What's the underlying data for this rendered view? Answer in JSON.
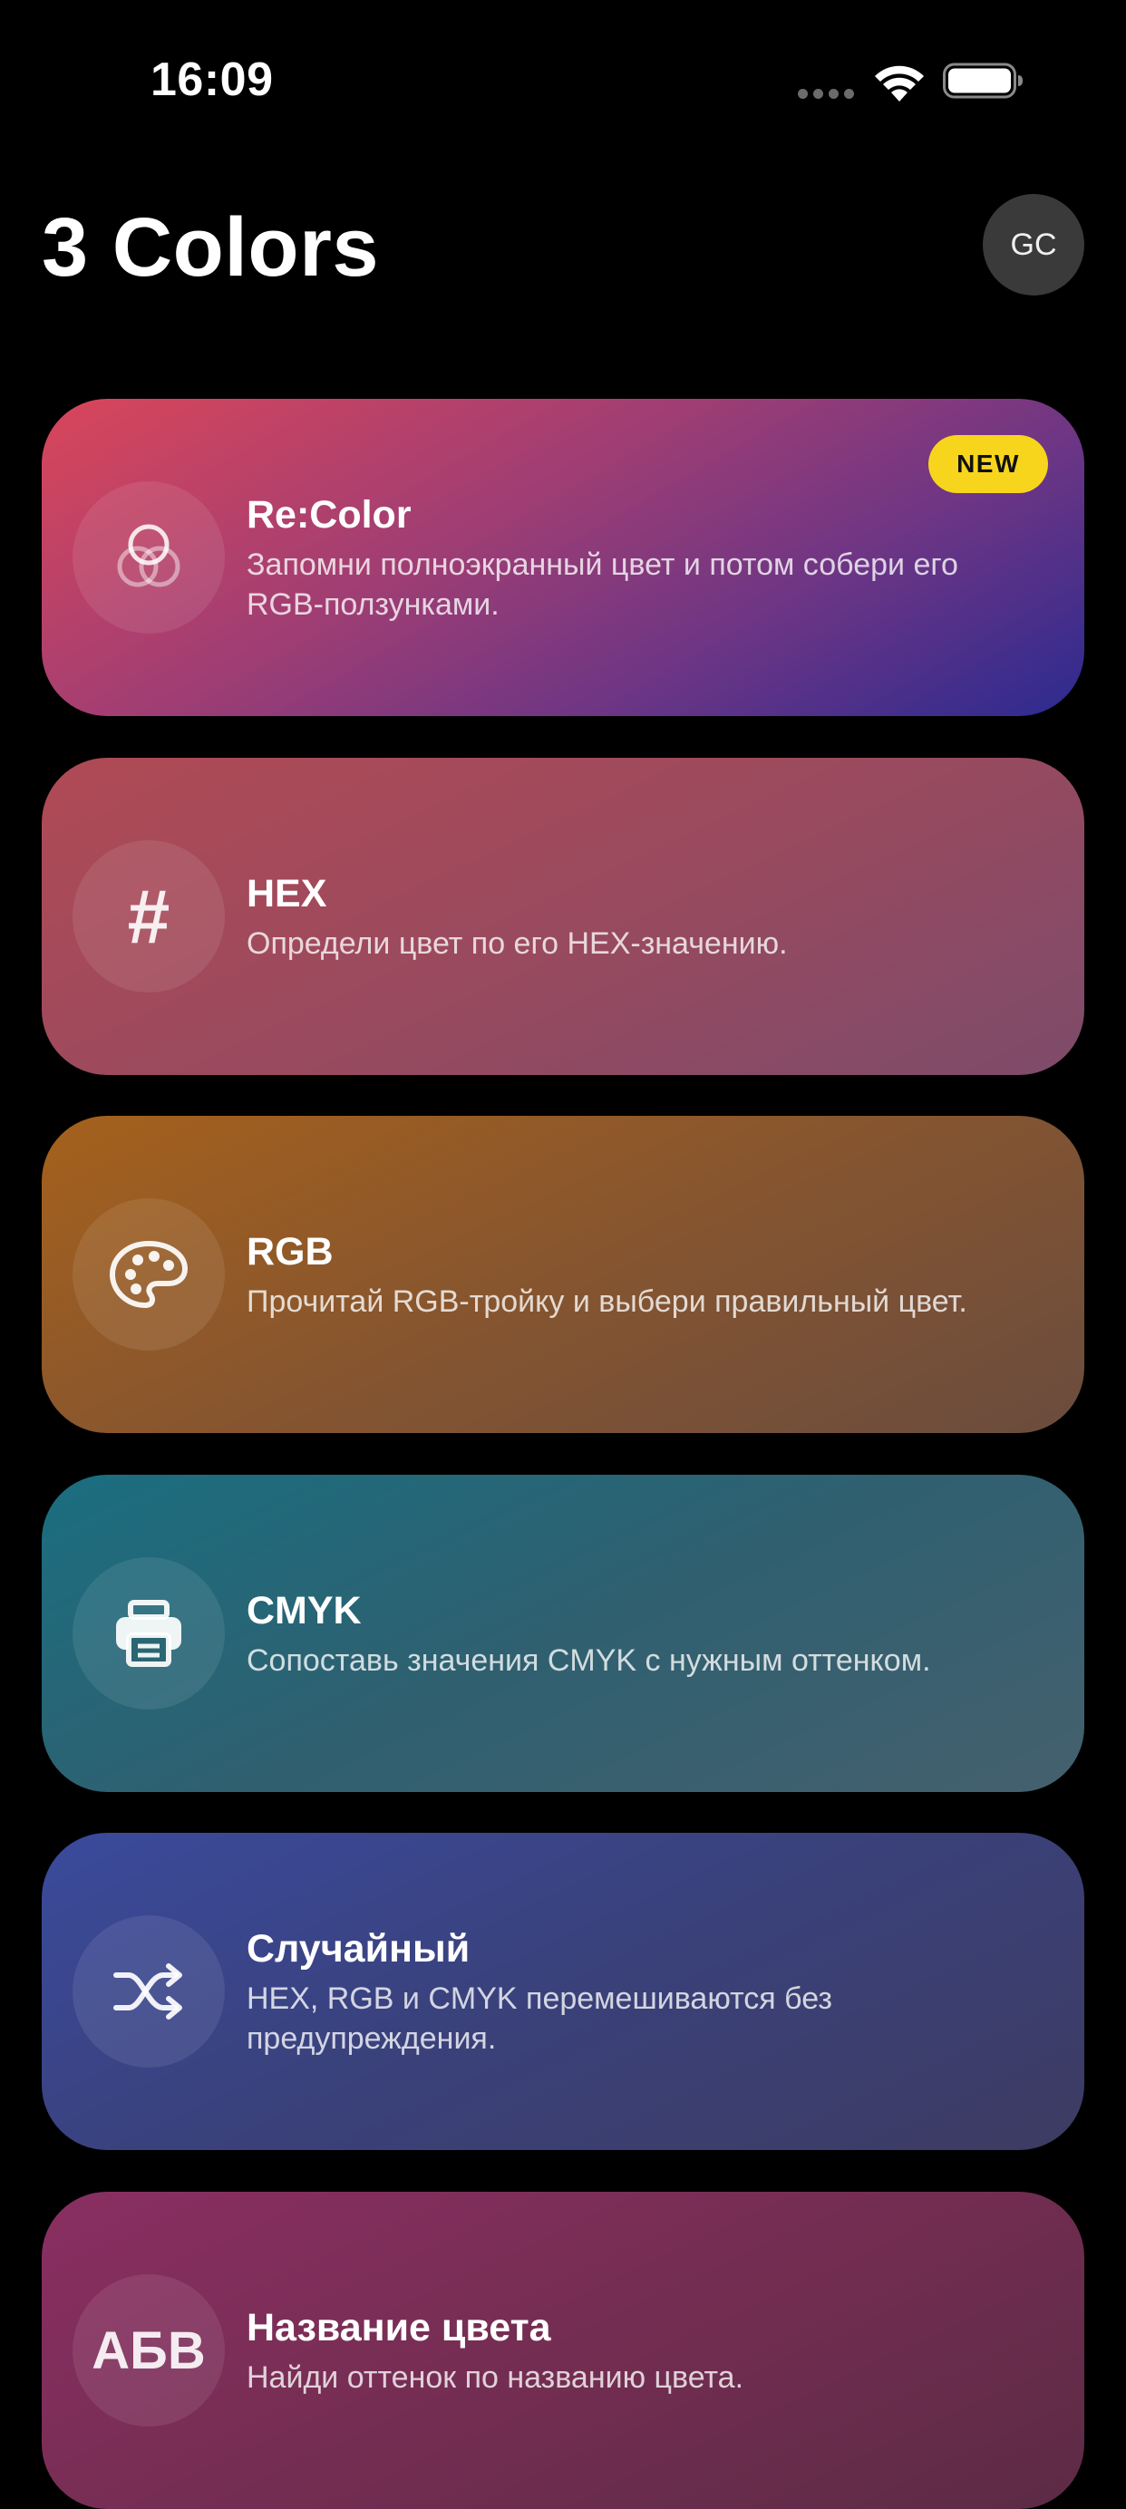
{
  "status_bar": {
    "time": "16:09"
  },
  "header": {
    "title": "3 Colors",
    "avatar_initials": "GC"
  },
  "cards": [
    {
      "id": "recolor",
      "title": "Re:Color",
      "description": "Запомни полноэкранный цвет и потом собери его RGB-ползунками.",
      "icon": "circles-icon",
      "badge": "NEW"
    },
    {
      "id": "hex",
      "title": "HEX",
      "description": "Определи цвет по его HEX-значению.",
      "icon": "hash-icon",
      "icon_glyph": "#"
    },
    {
      "id": "rgb",
      "title": "RGB",
      "description": "Прочитай RGB-тройку и выбери правильный цвет.",
      "icon": "palette-icon"
    },
    {
      "id": "cmyk",
      "title": "CMYK",
      "description": "Сопоставь значения CMYK с нужным оттенком.",
      "icon": "printer-icon"
    },
    {
      "id": "random",
      "title": "Случайный",
      "description": "HEX, RGB и CMYK перемешиваются без предупреждения.",
      "icon": "shuffle-icon"
    },
    {
      "id": "color-name",
      "title": "Название цвета",
      "description": "Найди оттенок по названию цвета.",
      "icon": "alphabet-icon",
      "icon_glyph": "АБВ"
    }
  ],
  "colors": {
    "background": "#000000",
    "badge": "#f7d51d",
    "avatar": "#3a3a3a"
  }
}
